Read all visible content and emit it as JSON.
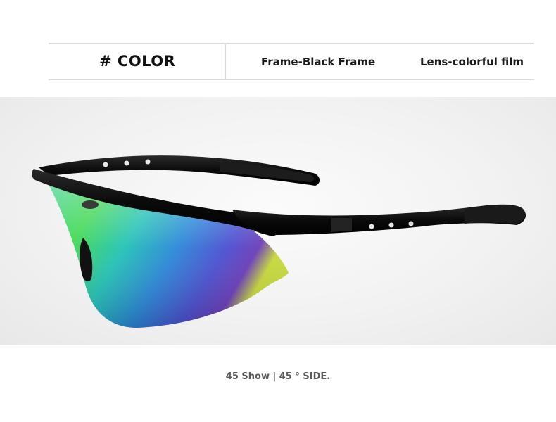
{
  "spec": {
    "title": "# COLOR",
    "frame": "Frame-Black Frame",
    "lens": "Lens-colorful film"
  },
  "product_image": {
    "subject": "sunglasses-icon",
    "colors": {
      "frame": "#0d0d0d",
      "lens_green": "#39d36b",
      "lens_teal": "#1fb3c8",
      "lens_blue": "#3a4fd6",
      "lens_purple": "#6a3bb8",
      "lens_yellow": "#c7d93a"
    }
  },
  "caption": {
    "text": "45 Show | 45 ° SIDE."
  }
}
